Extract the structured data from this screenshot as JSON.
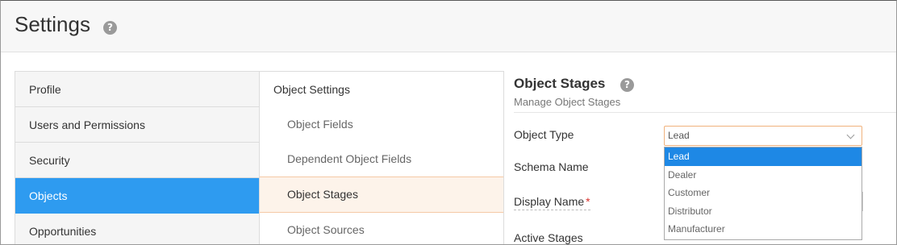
{
  "header": {
    "title": "Settings",
    "help_glyph": "?"
  },
  "nav": {
    "items": [
      {
        "label": "Profile"
      },
      {
        "label": "Users and Permissions"
      },
      {
        "label": "Security"
      },
      {
        "label": "Objects",
        "active": true
      },
      {
        "label": "Opportunities"
      }
    ]
  },
  "subnav": {
    "title": "Object Settings",
    "items": [
      {
        "label": "Object Fields"
      },
      {
        "label": "Dependent Object Fields"
      },
      {
        "label": "Object Stages",
        "active": true
      },
      {
        "label": "Object Sources"
      }
    ]
  },
  "panel": {
    "title": "Object Stages",
    "subtitle": "Manage Object Stages",
    "help_glyph": "?",
    "fields": {
      "object_type_label": "Object Type",
      "schema_name_label": "Schema Name",
      "display_name_label": "Display Name",
      "required_mark": "*",
      "active_stages_label": "Active Stages"
    },
    "object_type_value": "Lead",
    "dropdown_options": [
      "Lead",
      "Dealer",
      "Customer",
      "Distributor",
      "Manufacturer"
    ],
    "dropdown_selected": "Lead"
  },
  "colors": {
    "accent": "#2e9bf0",
    "active_sub_bg": "#fdf3ea",
    "focus_border": "#f0b27d",
    "dropdown_selected": "#1e88e5",
    "required": "#d9302c"
  },
  "icons": {
    "help": "question-circle-icon",
    "chevron": "chevron-down-icon"
  }
}
